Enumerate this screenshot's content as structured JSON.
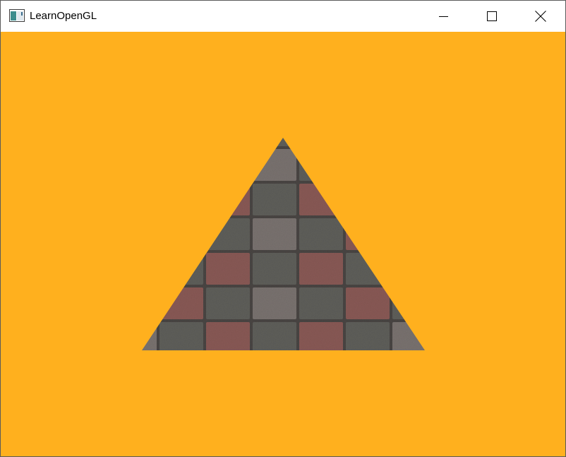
{
  "window": {
    "title": "LearnOpenGL",
    "app_icon": "opengl-window-icon",
    "controls": {
      "minimize_icon": "minimize-icon",
      "maximize_icon": "maximize-icon",
      "close_icon": "close-icon"
    }
  },
  "viewport": {
    "clear_color": "#ffb01e",
    "primitive": "textured-triangle",
    "texture": "checkered-brick-paving-texture",
    "texture_colors": {
      "dark_tile": "#5f5f5b",
      "red_tile": "#8a5a56",
      "grey_tile": "#7a7370",
      "mortar": "#4a4644"
    }
  }
}
